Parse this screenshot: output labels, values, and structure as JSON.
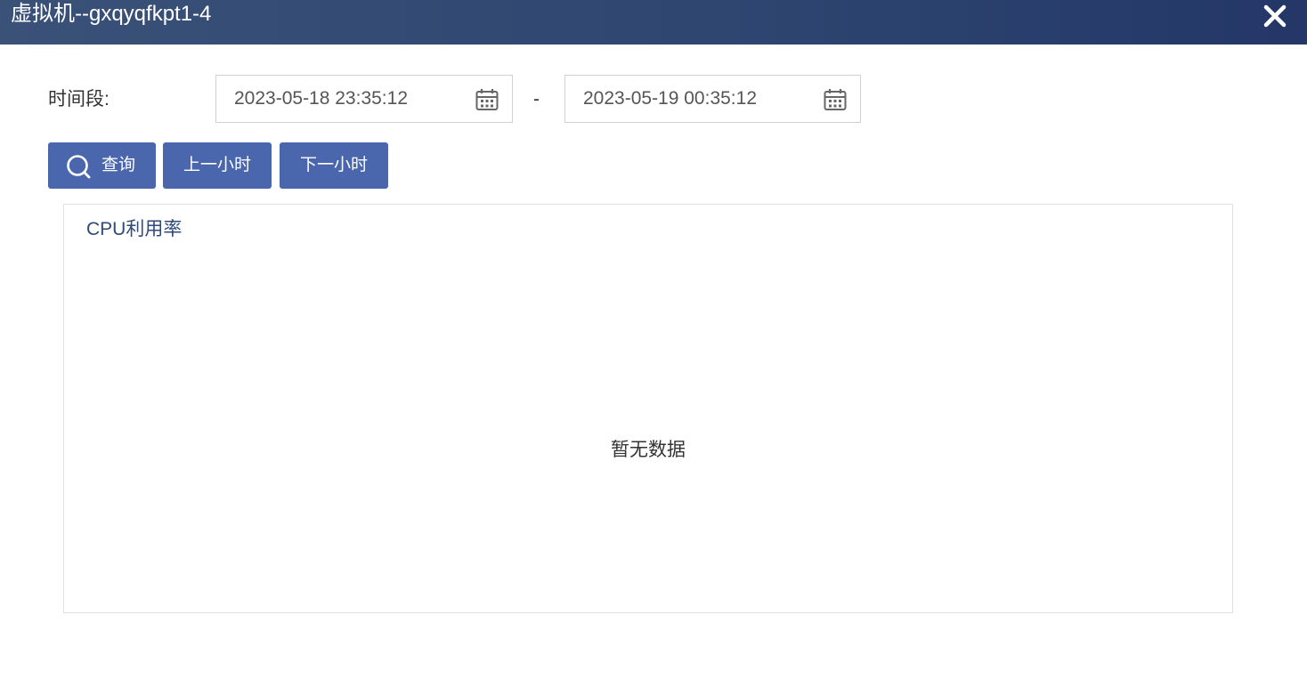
{
  "dialog": {
    "title": "虚拟机--gxqyqfkpt1-4",
    "close_icon": "close-icon"
  },
  "filter": {
    "label": "时间段:",
    "start_value": "2023-05-18 23:35:12",
    "end_value": "2023-05-19 00:35:12",
    "separator": "-",
    "calendar_icon": "calendar-icon"
  },
  "buttons": {
    "query_label": "查询",
    "query_icon": "search-icon",
    "prev_hour_label": "上一小时",
    "next_hour_label": "下一小时",
    "color": "#4a67ad"
  },
  "chart": {
    "title": "CPU利用率",
    "empty_text": "暂无数据"
  },
  "colors": {
    "title_bar": "#2e4670",
    "chart_title": "#2f4a78"
  }
}
